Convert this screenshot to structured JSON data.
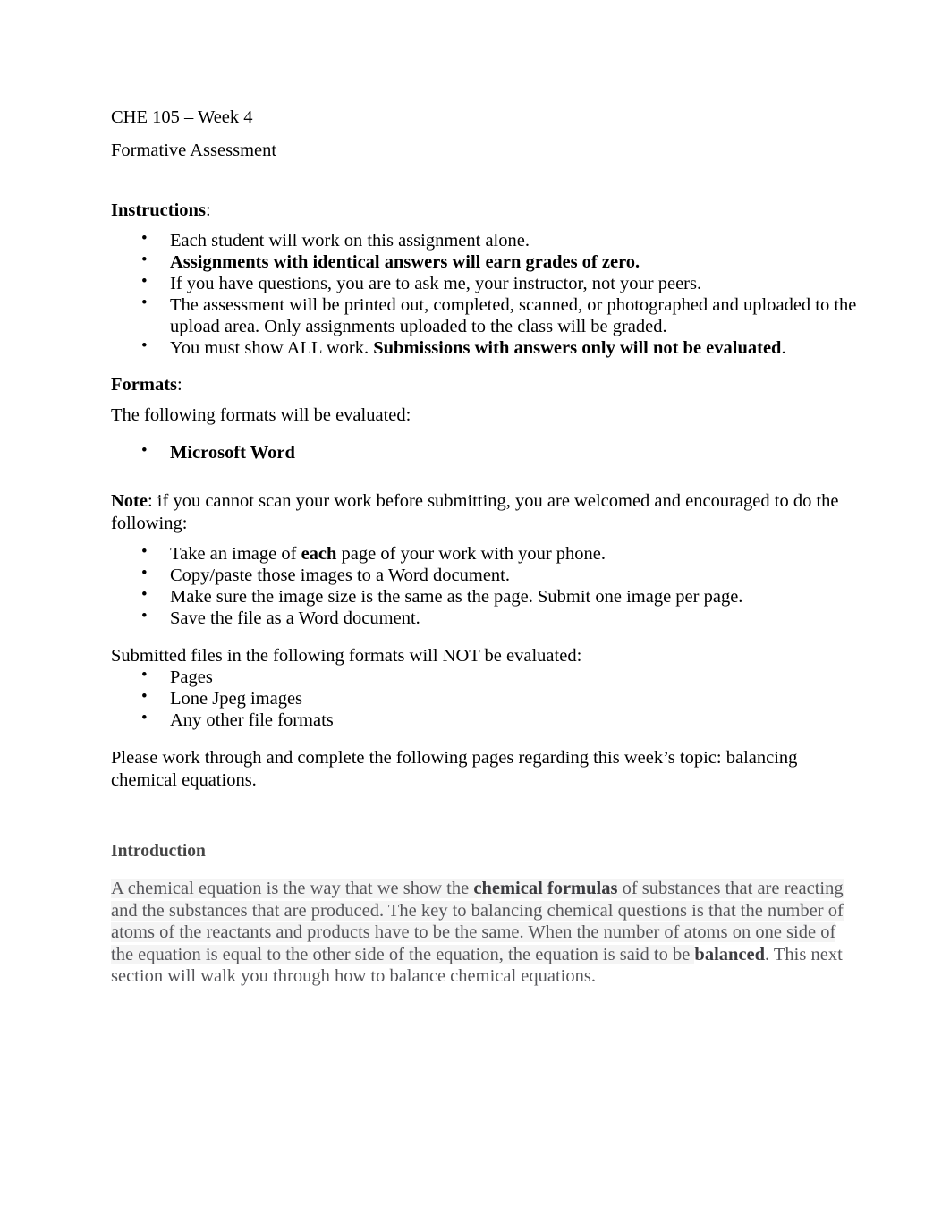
{
  "document": {
    "course_line": "CHE 105 – Week 4",
    "subtitle": "Formative Assessment"
  },
  "instructions": {
    "heading": "Instructions",
    "heading_punct": ":",
    "items": [
      {
        "text": "Each student will work on this assignment alone.",
        "bold": false
      },
      {
        "text": "Assignments with identical answers will earn grades of zero.",
        "bold": true
      },
      {
        "text": "If you have questions, you are to ask me, your instructor, not your peers.",
        "bold": false
      },
      {
        "text": "The assessment will be printed out, completed, scanned, or photographed and uploaded to the upload area. Only assignments uploaded to the class will be graded.",
        "bold": false
      }
    ],
    "last_item": {
      "plain_prefix": "You must show ALL work.  ",
      "bold_part": "Submissions with answers only will not be evaluated",
      "plain_suffix": "."
    }
  },
  "formats": {
    "heading": "Formats",
    "heading_punct": ":",
    "lead_in": "The following formats will be evaluated:",
    "accepted": [
      {
        "text": "Microsoft Word",
        "bold": true
      }
    ]
  },
  "note": {
    "label": "Note",
    "body": ": if you cannot scan your work before submitting, you are welcomed and encouraged to do the following:",
    "steps": [
      {
        "pre": "Take an image of ",
        "bold": "each",
        "post": " page of your work with your phone."
      },
      {
        "pre": "Copy/paste those images to a Word document.",
        "bold": "",
        "post": ""
      },
      {
        "pre": "Make sure the image size is the same as the page. Submit one image per page.",
        "bold": "",
        "post": ""
      },
      {
        "pre": "Save the file as a Word document.",
        "bold": "",
        "post": ""
      }
    ]
  },
  "rejected": {
    "lead_in": "Submitted files in the following formats will NOT be evaluated:",
    "items": [
      "Pages",
      "Lone Jpeg images",
      "Any other file formats"
    ]
  },
  "closing": {
    "text": "Please work through and complete the following pages regarding this week’s topic: balancing chemical equations."
  },
  "introduction": {
    "heading": "Introduction",
    "seg1": "A chemical equation is the way that we show the ",
    "bold1": "chemical formulas",
    "seg2": " of substances that are reacting and the substances that are produced. The key to balancing chemical questions is that the number of atoms of the reactants and products have to be the same. When the number of atoms on one side of the equation is equal to the other side of the equation, the equation is said to be ",
    "bold2": "balanced",
    "seg3": ".  This next section will walk you through how to balance chemical equations."
  }
}
